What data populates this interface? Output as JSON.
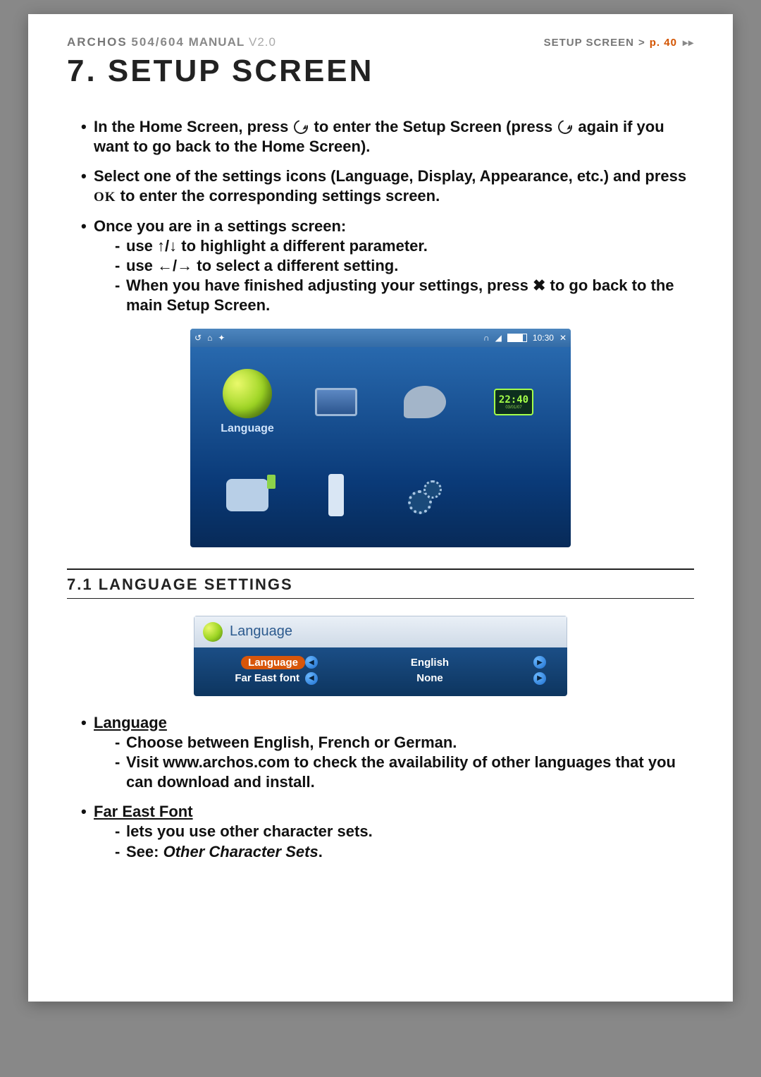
{
  "header": {
    "brand": "ARCHOS",
    "model": "504/604",
    "manual": "MANUAL",
    "version": "V2.0",
    "section": "SETUP SCREEN",
    "sep": ">",
    "page_label": "p. 40"
  },
  "title": "7. SETUP SCREEN",
  "bullets": {
    "b1a": "In the Home Screen, press ",
    "b1b": " to enter the Setup Screen (press ",
    "b1c": " again if you want to go back to the Home Screen).",
    "b2a": "Select one of the settings icons (Language, Display, Appearance, etc.) and press ",
    "b2_ok": "OK",
    "b2b": " to enter the corresponding settings screen.",
    "b3": "Once you are in a settings screen:",
    "b3i1a": "use ",
    "b3i1_arrows": "↑/↓",
    "b3i1b": " to highlight a different parameter.",
    "b3i2a": "use ",
    "b3i2_arrows": "←/→",
    "b3i2b": " to select a different setting.",
    "b3i3a": "When you have finished adjusting your settings, press ",
    "b3i3_x": "✖",
    "b3i3b": " to go back to the main Setup Screen."
  },
  "screenshot1": {
    "time": "10:30",
    "language_label": "Language",
    "clock_time": "22:40",
    "clock_date": "03/01/07"
  },
  "section_71": "7.1  LANGUAGE SETTINGS",
  "screenshot2": {
    "header": "Language",
    "row1_label": "Language",
    "row1_value": "English",
    "row2_label": "Far East font",
    "row2_value": "None"
  },
  "lang_section": {
    "lang_title": "Language",
    "lang_i1": "Choose between English, French or German.",
    "lang_i2": "Visit www.archos.com to check the availability of other languages that you can download and install.",
    "fef_title": "Far East Font",
    "fef_i1": "lets you use other character sets.",
    "fef_i2a": "See: ",
    "fef_i2b": "Other Character Sets",
    "fef_i2c": "."
  }
}
